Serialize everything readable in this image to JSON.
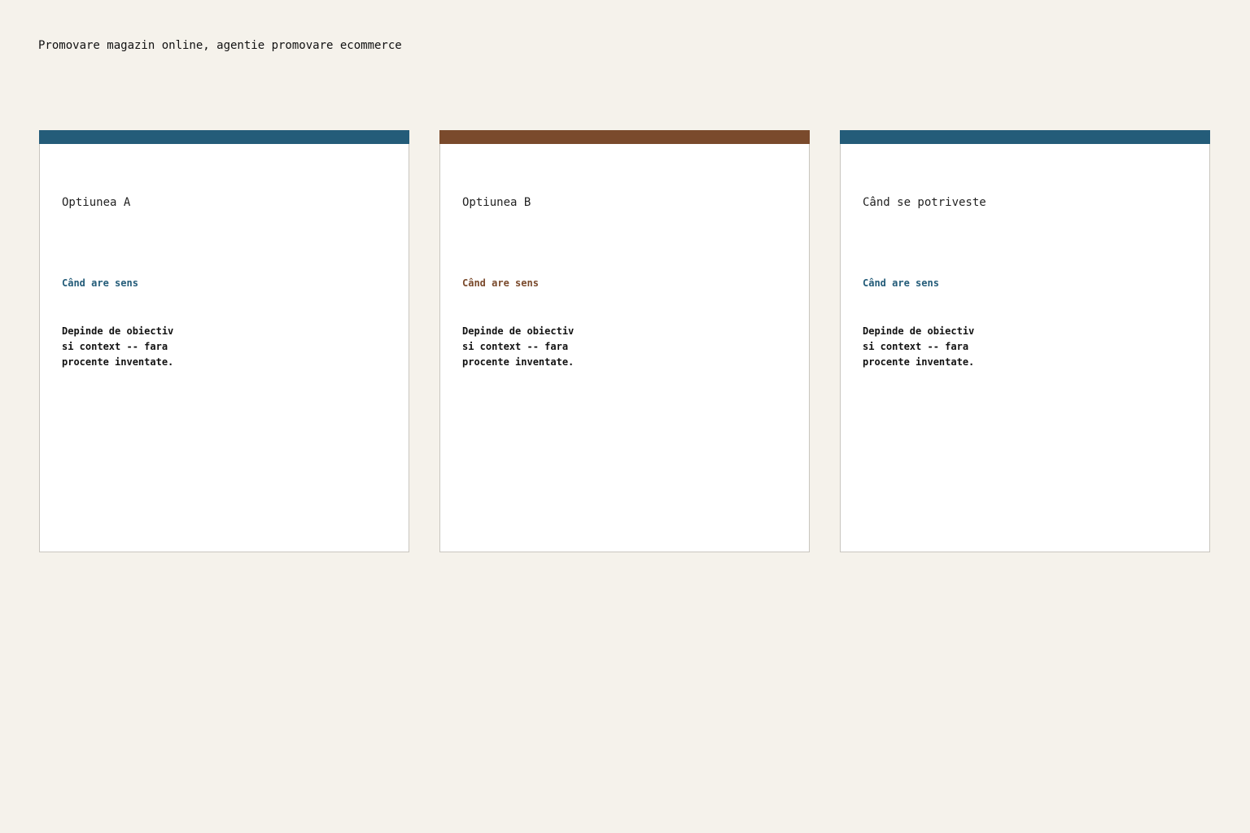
{
  "page": {
    "title": "Promovare magazin online, agentie promovare ecommerce"
  },
  "colors": {
    "background": "#f5f2eb",
    "blue": "#245c79",
    "brown": "#7a4a2c"
  },
  "cards": [
    {
      "heading": "Optiunea A",
      "sublabel": "Când are sens",
      "body": "Depinde de obiectiv\nsi context -- fara\nprocente inventate.",
      "accent": "#245c79"
    },
    {
      "heading": "Optiunea B",
      "sublabel": "Când are sens",
      "body": "Depinde de obiectiv\nsi context -- fara\nprocente inventate.",
      "accent": "#7a4a2c"
    },
    {
      "heading": "Când se potriveste",
      "sublabel": "Când are sens",
      "body": "Depinde de obiectiv\nsi context -- fara\nprocente inventate.",
      "accent": "#245c79"
    }
  ]
}
